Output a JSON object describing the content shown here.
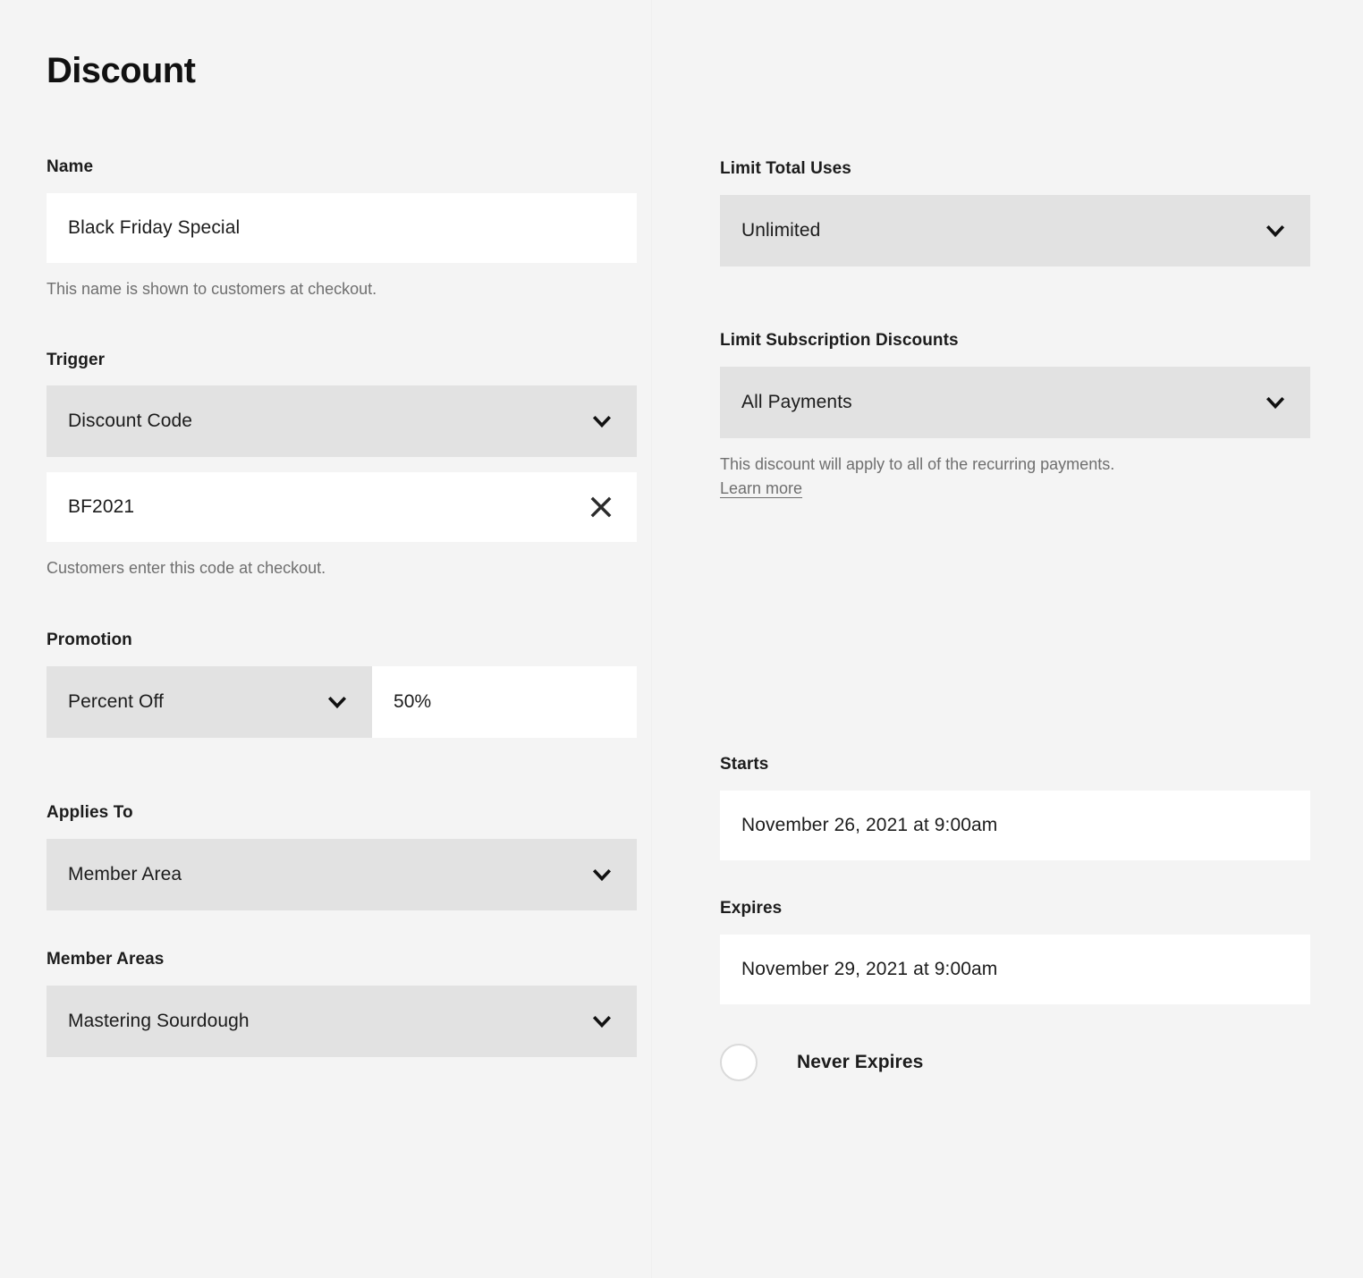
{
  "page": {
    "title": "Discount",
    "background_color": "#f4f4f4",
    "select_color": "#e2e2e2",
    "input_color": "#ffffff"
  },
  "left_column": {
    "name": {
      "label": "Name",
      "value": "Black Friday Special",
      "helper": "This name is shown to customers at checkout."
    },
    "trigger": {
      "label": "Trigger",
      "select_value": "Discount Code",
      "code_value": "BF2021",
      "clear_icon": "close-icon",
      "helper": "Customers enter this code at checkout."
    },
    "promotion": {
      "label": "Promotion",
      "type_value": "Percent Off",
      "amount_value": "50%"
    },
    "applies_to": {
      "label": "Applies To",
      "value": "Member Area"
    },
    "member_areas": {
      "label": "Member Areas",
      "value": "Mastering Sourdough"
    }
  },
  "right_column": {
    "limit_total_uses": {
      "label": "Limit Total Uses",
      "value": "Unlimited"
    },
    "limit_subscription_discounts": {
      "label": "Limit Subscription Discounts",
      "value": "All Payments",
      "helper_text": "This discount will apply to all of the recurring payments. ",
      "helper_link": "Learn more"
    },
    "starts": {
      "label": "Starts",
      "value": "November 26, 2021 at 9:00am"
    },
    "expires": {
      "label": "Expires",
      "value": "November 29, 2021 at 9:00am",
      "never_expires_label": "Never Expires",
      "never_expires_selected": false
    }
  },
  "icons": {
    "chevron": "chevron-down-icon",
    "close": "close-icon",
    "radio": "radio-button-icon"
  }
}
